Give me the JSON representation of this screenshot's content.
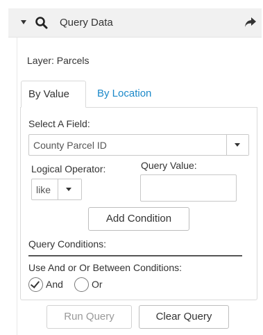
{
  "header": {
    "title": "Query Data",
    "collapse_icon": "caret-down-icon",
    "search_icon": "search-icon",
    "share_icon": "share-arrow-icon"
  },
  "layer": {
    "label": "Layer: Parcels"
  },
  "tabs": [
    {
      "label": "By Value",
      "active": true
    },
    {
      "label": "By Location",
      "active": false
    }
  ],
  "field_select": {
    "label": "Select A Field:",
    "value": "County Parcel ID"
  },
  "operator": {
    "label": "Logical Operator:",
    "value": "like"
  },
  "query_value": {
    "label": "Query Value:",
    "value": ""
  },
  "buttons": {
    "add_condition": "Add Condition",
    "run_query": "Run Query",
    "clear_query": "Clear Query"
  },
  "conditions": {
    "label": "Query Conditions:"
  },
  "combine": {
    "label": "Use And or Or Between Conditions:",
    "options": [
      {
        "label": "And",
        "checked": true
      },
      {
        "label": "Or",
        "checked": false
      }
    ]
  },
  "colors": {
    "accent_link": "#1a88c9",
    "header_bg": "#f1f1f1",
    "text": "#333333",
    "disabled_text": "#999999"
  }
}
